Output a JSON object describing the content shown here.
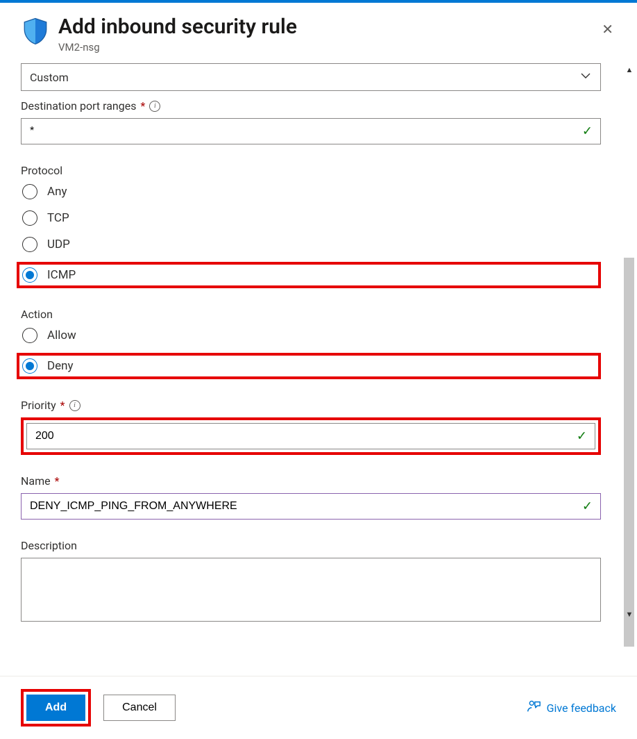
{
  "header": {
    "title": "Add inbound security rule",
    "subtitle": "VM2-nsg"
  },
  "service_dropdown": {
    "selected": "Custom"
  },
  "dest_port": {
    "label": "Destination port ranges",
    "value": "*"
  },
  "protocol": {
    "label": "Protocol",
    "options": [
      "Any",
      "TCP",
      "UDP",
      "ICMP"
    ],
    "selected": "ICMP"
  },
  "action": {
    "label": "Action",
    "options": [
      "Allow",
      "Deny"
    ],
    "selected": "Deny"
  },
  "priority": {
    "label": "Priority",
    "value": "200"
  },
  "name": {
    "label": "Name",
    "value": "DENY_ICMP_PING_FROM_ANYWHERE"
  },
  "description": {
    "label": "Description",
    "value": ""
  },
  "footer": {
    "add": "Add",
    "cancel": "Cancel",
    "feedback": "Give feedback"
  }
}
